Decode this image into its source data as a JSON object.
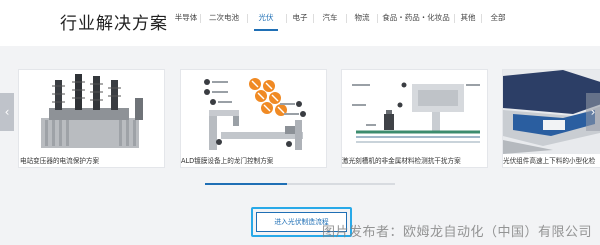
{
  "header": {
    "title": "行业解决方案",
    "tabs": [
      {
        "label": "半导体",
        "active": false
      },
      {
        "label": "二次电池",
        "active": false
      },
      {
        "label": "光伏",
        "active": true
      },
      {
        "label": "电子",
        "active": false
      },
      {
        "label": "汽车",
        "active": false
      },
      {
        "label": "物流",
        "active": false
      },
      {
        "label": "食品・药品・化妆品",
        "active": false
      },
      {
        "label": "其他",
        "active": false
      },
      {
        "label": "全部",
        "active": false
      }
    ]
  },
  "carousel": {
    "prev_icon": "chevron-left-icon",
    "next_icon": "chevron-right-icon",
    "cards": [
      {
        "caption": "电站变压器的电流保护方案"
      },
      {
        "caption": "ALD镀膜设备上的龙门控制方案"
      },
      {
        "caption": "激光刻槽机的非金属材料检测抗干扰方案"
      },
      {
        "caption": "光伏组件高速上下料的小型化检"
      }
    ],
    "progress": 0.43
  },
  "cta": {
    "label": "进入光伏制造流程"
  },
  "watermark": {
    "text": "图片发布者：欧姆龙自动化（中国）有限公司"
  },
  "colors": {
    "accent": "#1f6fb5",
    "highlight_frame": "#28a9e8",
    "background": "#f2f3f5"
  }
}
